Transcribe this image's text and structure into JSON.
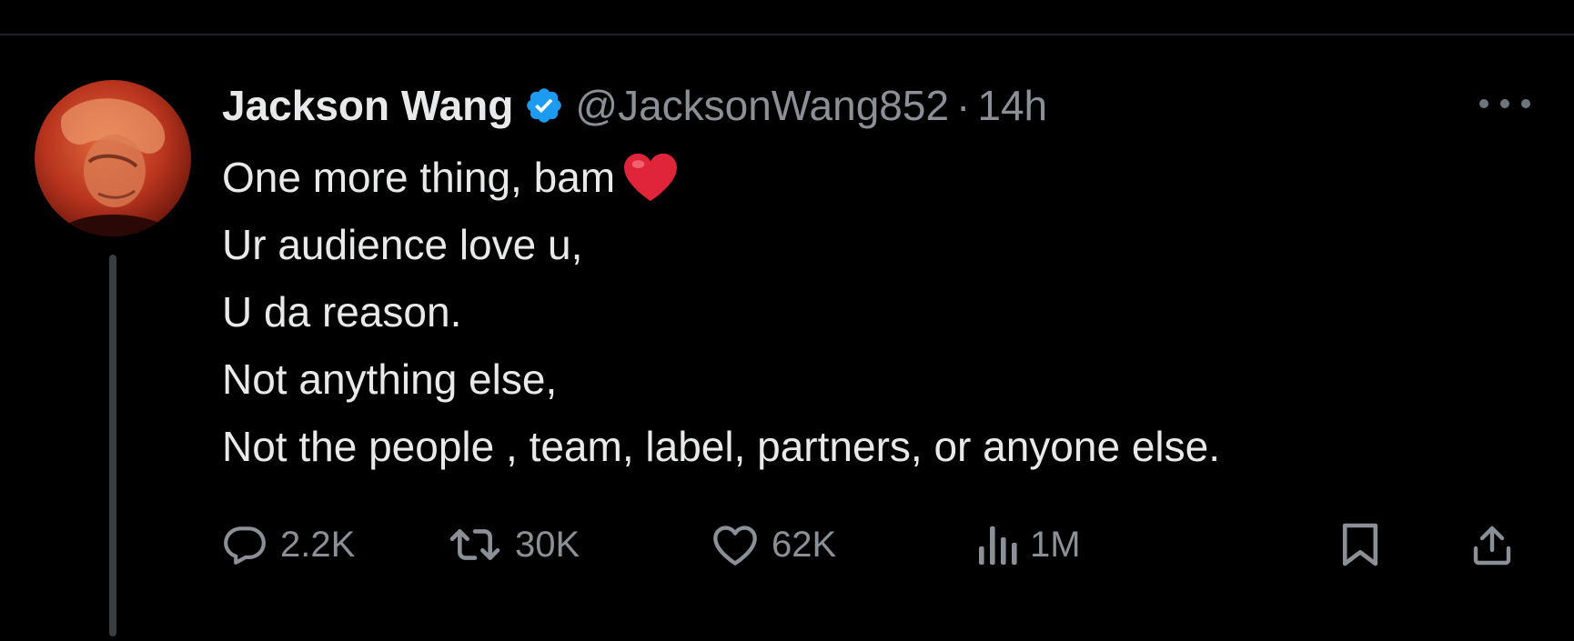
{
  "author": {
    "display_name": "Jackson Wang",
    "handle": "@JacksonWang852",
    "separator": "·",
    "time_ago": "14h",
    "verified": true,
    "verified_color": "#1d9bf0"
  },
  "tweet": {
    "lines": [
      "One more thing, bam",
      "Ur audience love u,",
      "U da reason.",
      "Not anything else,",
      "Not the people , team, label, partners, or anyone else."
    ],
    "emoji": "heart-emoji"
  },
  "actions": {
    "replies": "2.2K",
    "reposts": "30K",
    "likes": "62K",
    "views": "1M"
  },
  "icons": [
    "more-icon",
    "reply-icon",
    "repost-icon",
    "like-icon",
    "views-icon",
    "bookmark-icon",
    "share-icon",
    "verified-badge-icon"
  ],
  "colors": {
    "background": "#000000",
    "text": "#e7e9ea",
    "secondary_text": "#8b9097"
  }
}
